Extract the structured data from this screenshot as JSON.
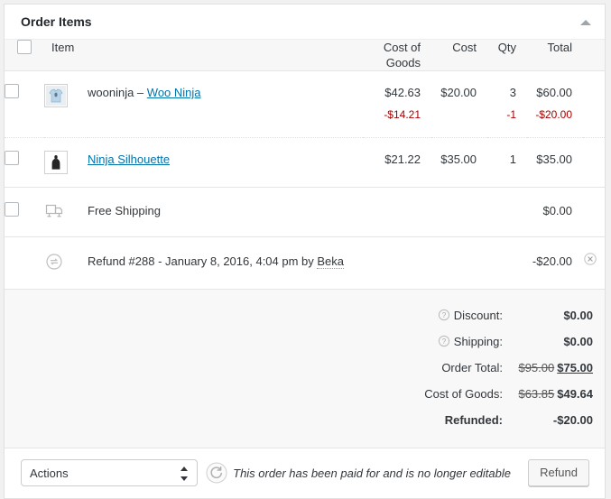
{
  "panel": {
    "title": "Order Items",
    "toggle_icon": "triangle-up-icon"
  },
  "table": {
    "columns": {
      "item": "Item",
      "cost_of_goods": "Cost of Goods",
      "cost": "Cost",
      "qty": "Qty",
      "total": "Total"
    },
    "rows": [
      {
        "type": "line_item",
        "thumb_icon": "tshirt-thumbnail",
        "name_prefix": "wooninja – ",
        "name_link": "Woo Ninja",
        "cost_of_goods": "$42.63",
        "cost_of_goods_refund": "-$14.21",
        "cost": "$20.00",
        "qty": "3",
        "qty_refund": "-1",
        "total": "$60.00",
        "total_refund": "-$20.00"
      },
      {
        "type": "line_item",
        "thumb_icon": "hoodie-thumbnail",
        "name_prefix": "",
        "name_link": "Ninja Silhouette",
        "cost_of_goods": "$21.22",
        "cost_of_goods_refund": "",
        "cost": "$35.00",
        "qty": "1",
        "qty_refund": "",
        "total": "$35.00",
        "total_refund": ""
      }
    ],
    "shipping_row": {
      "icon": "shipping-truck-icon",
      "label": "Free Shipping",
      "total": "$0.00"
    },
    "refund_row": {
      "icon": "refund-circle-icon",
      "text_before": "Refund #288 - January 8, 2016, 4:04 pm by ",
      "author": "Beka",
      "amount": "-$20.00",
      "delete_icon": "delete-circle-x-icon"
    }
  },
  "totals": [
    {
      "label": "Discount:",
      "help": true,
      "old_value": "",
      "value": "$0.00",
      "style": "normal"
    },
    {
      "label": "Shipping:",
      "help": true,
      "old_value": "",
      "value": "$0.00",
      "style": "normal"
    },
    {
      "label": "Order Total:",
      "help": false,
      "old_value": "$95.00",
      "value": "$75.00",
      "style": "underline"
    },
    {
      "label": "Cost of Goods:",
      "help": false,
      "old_value": "$63.85",
      "value": "$49.64",
      "style": "normal"
    },
    {
      "label": "Refunded:",
      "help": false,
      "old_value": "",
      "value": "-$20.00",
      "style": "danger"
    }
  ],
  "toolbar": {
    "actions_select": "Actions",
    "refresh_icon": "refresh-circle-icon",
    "note": "This order has been paid for and is no longer editable",
    "refund_button": "Refund"
  },
  "colors": {
    "link": "#0073aa",
    "danger": "#a00",
    "text": "#32373c",
    "panel_bg": "#ffffff",
    "header_bg": "#f7f7f7",
    "totals_bg": "#f8f8f8",
    "page_bg": "#f1f1f1"
  }
}
